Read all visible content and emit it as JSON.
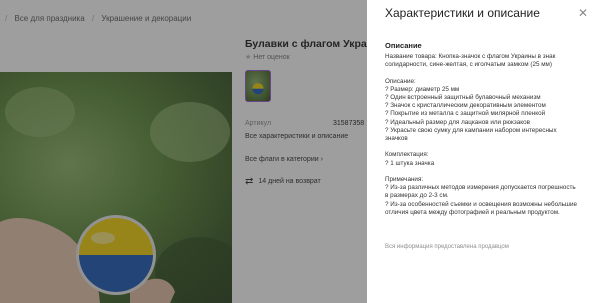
{
  "breadcrumbs": [
    "Все для праздника",
    "Украшение и декорации"
  ],
  "product": {
    "title": "Булавки с флагом Украины",
    "rating_text": "Нет оценок",
    "article_label": "Артикул",
    "article_value": "31587358",
    "all_specs_link": "Все характеристики и описание",
    "all_flags_link": "Все флаги в категории",
    "return_text": "14 дней на возврат"
  },
  "panel": {
    "title": "Характеристики и описание",
    "section_heading": "Описание",
    "lines": [
      "Название товара: Кнопка-значок с флагом Украины в знак",
      "солидарности, сине-желтая, с иголчатым замком (25 мм)",
      "",
      "Описание:",
      "? Размер: диаметр 25 мм",
      "? Один встроенный защитный булавочный механизм",
      "? Значок с кристаллическим декоративным элементом",
      "? Покрытие из металла с защитной милярной пленкой",
      "? Идеальный размер для лацканов или рюкзаков",
      "? Украсьте свою сумку для кампании набором интересных",
      "значков",
      "",
      "Комплектация:",
      "? 1 штука значка",
      "",
      "Примечания:",
      "? Из-за различных методов измерения допускается погрешность",
      "в размерах до 2-3 см.",
      "? Из-за особенностей съемки и освещения возможны небольшие",
      "отличия цвета между фотографией и реальным продуктом."
    ],
    "footnote": "Вся информация предоставлена продавцом"
  },
  "icons": {
    "close": "close-icon",
    "star": "star-icon",
    "return": "return-arrows-icon"
  },
  "colors": {
    "flag_blue": "#1f5bb8",
    "flag_yellow": "#f5d20f",
    "thumb_border": "#a257d7",
    "overlay": "#282828"
  }
}
